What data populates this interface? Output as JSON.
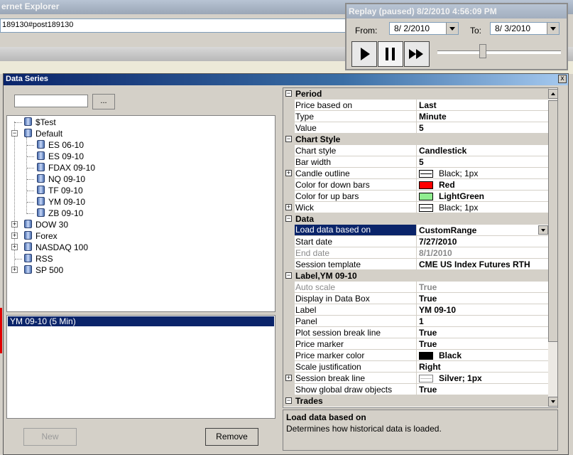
{
  "browser": {
    "title": "ernet Explorer",
    "address": "189130#post189130"
  },
  "replay": {
    "title": "Replay (paused) 8/2/2010 4:56:09 PM",
    "from_label": "From:",
    "from_value": "8/ 2/2010",
    "to_label": "To:",
    "to_value": "8/ 3/2010",
    "slider_position": 0.36
  },
  "dialog": {
    "title": "Data Series",
    "close": "x",
    "filter_button": "...",
    "new_button": "New",
    "remove_button": "Remove",
    "series_list": [
      "YM 09-10 (5 Min)"
    ],
    "tree": [
      {
        "label": "$Test"
      },
      {
        "label": "Default",
        "expanded": true,
        "children": [
          "ES 06-10",
          "ES 09-10",
          "FDAX 09-10",
          "NQ 09-10",
          "TF 09-10",
          "YM 09-10",
          "ZB 09-10"
        ]
      },
      {
        "label": "DOW 30"
      },
      {
        "label": "Forex"
      },
      {
        "label": "NASDAQ 100"
      },
      {
        "label": "RSS"
      },
      {
        "label": "SP 500"
      }
    ]
  },
  "properties": {
    "period": {
      "label": "Period",
      "price_based_on": [
        "Price based on",
        "Last"
      ],
      "type": [
        "Type",
        "Minute"
      ],
      "value": [
        "Value",
        "5"
      ]
    },
    "chart_style": {
      "label": "Chart Style",
      "chart_style": [
        "Chart style",
        "Candlestick"
      ],
      "bar_width": [
        "Bar width",
        "5"
      ],
      "candle_outline": [
        "Candle outline",
        "Black; 1px"
      ],
      "down_bars": [
        "Color for down bars",
        "Red"
      ],
      "up_bars": [
        "Color for up bars",
        "LightGreen"
      ],
      "wick": [
        "Wick",
        "Black; 1px"
      ]
    },
    "data": {
      "label": "Data",
      "load_data": [
        "Load data based on",
        "CustomRange"
      ],
      "start_date": [
        "Start date",
        "7/27/2010"
      ],
      "end_date": [
        "End date",
        "8/1/2010"
      ],
      "session_template": [
        "Session template",
        "CME US Index Futures RTH"
      ]
    },
    "visual": {
      "label": [
        "Label",
        "YM 09-10"
      ],
      "auto_scale": [
        "Auto scale",
        "True"
      ],
      "display_data_box": [
        "Display in Data Box",
        "True"
      ],
      "panel": [
        "Panel",
        "1"
      ],
      "plot_session_break": [
        "Plot session break line",
        "True"
      ],
      "price_marker": [
        "Price marker",
        "True"
      ],
      "price_marker_color": [
        "Price marker color",
        "Black"
      ],
      "scale_justification": [
        "Scale justification",
        "Right"
      ],
      "session_break_line": [
        "Session break line",
        "Silver; 1px"
      ],
      "show_global_draw": [
        "Show global draw objects",
        "True"
      ]
    },
    "trades": {
      "label": "Trades"
    }
  },
  "colors": {
    "red": "#ff0000",
    "lightgreen": "#90ee90",
    "black": "#000000",
    "silver": "#ffffff",
    "selection": "#0a246a"
  },
  "help": {
    "title": "Load data based on",
    "text": "Determines how historical data is loaded."
  }
}
